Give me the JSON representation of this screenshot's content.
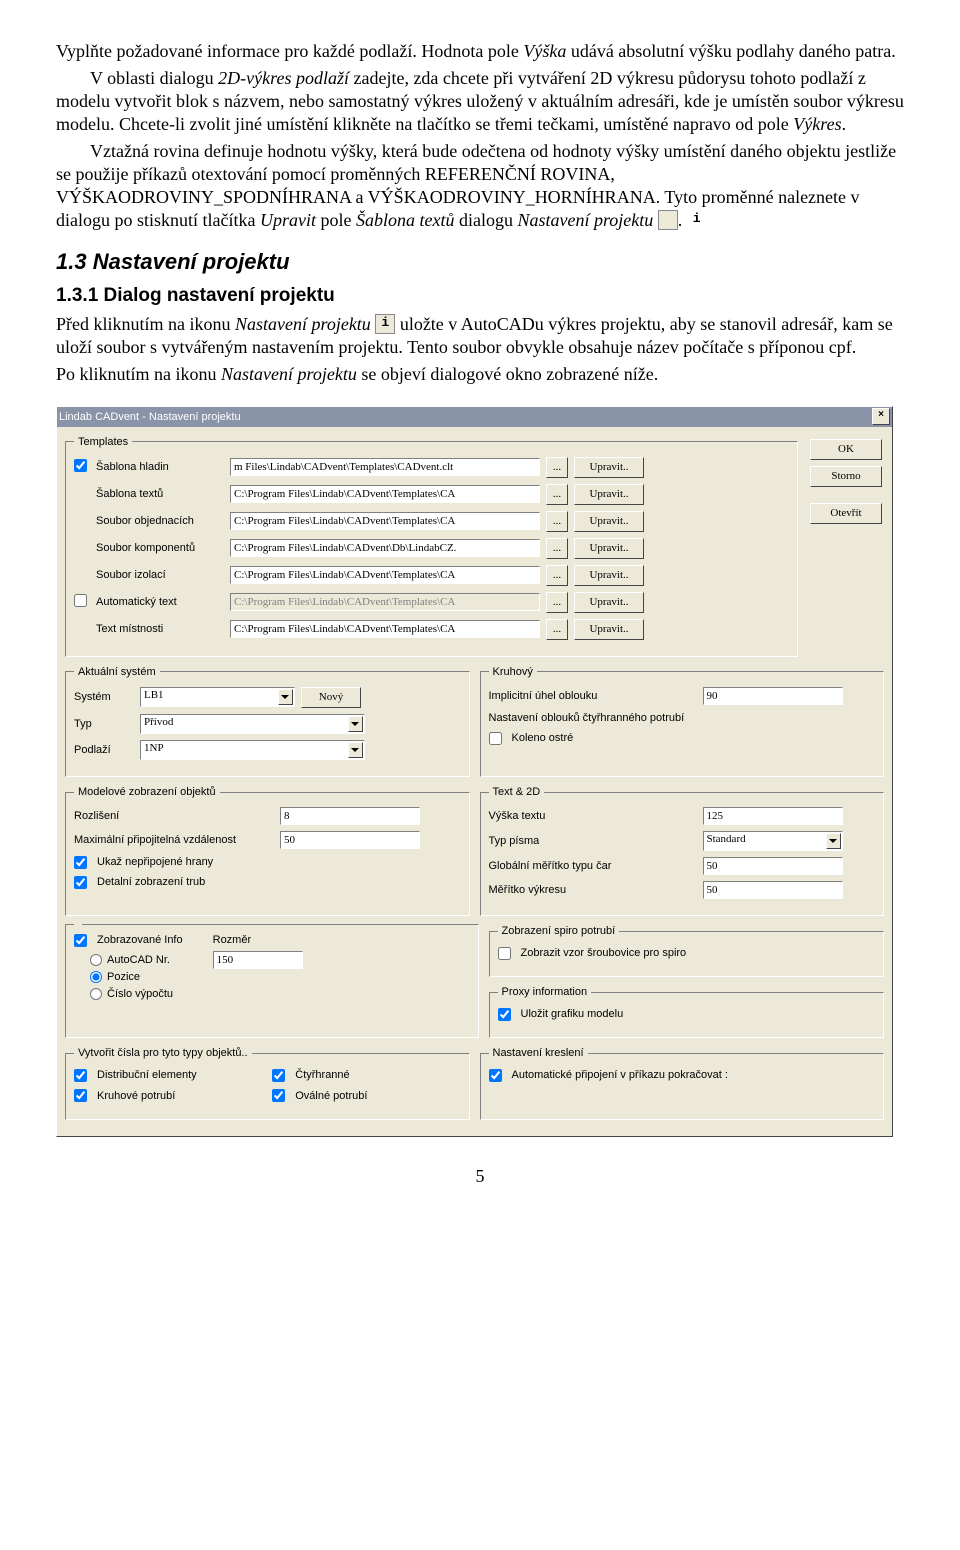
{
  "doc": {
    "p1a": "Vyplňte požadované informace pro každé podlaží. Hodnota pole ",
    "p1b": "Výška",
    "p1c": " udává absolutní výšku podlahy daného patra.",
    "p2a": "V oblasti dialogu ",
    "p2b": "2D-výkres podlaží",
    "p2c": " zadejte, zda chcete při vytváření 2D výkresu půdorysu tohoto podlaží z modelu vytvořit blok s názvem, nebo samostatný výkres uložený v aktuálním adresáři, kde je umístěn soubor výkresu modelu. Chcete-li zvolit jiné umístění klikněte na tlačítko se třemi tečkami, umístěné napravo od pole ",
    "p2d": "Výkres",
    "p2e": ".",
    "p3": "Vztažná rovina definuje hodnotu výšky, která bude odečtena od hodnoty výšky umístění daného objektu jestliže se použije příkazů otextování pomocí proměnných REFERENČNÍ ROVINA, VÝŠKAODROVINY_SPODNÍHRANA a VÝŠKAODROVINY_HORNÍHRANA. Tyto proměnné naleznete v dialogu po stisknutí tlačítka ",
    "p3b": "Upravit",
    "p3c": " pole ",
    "p3d": "Šablona textů",
    "p3e": " dialogu ",
    "p3f": "Nastavení projektu",
    "p3g": ".",
    "h2": "1.3  Nastavení projektu",
    "h3": "1.3.1  Dialog nastavení projektu",
    "p4a": "Před kliknutím na ikonu  ",
    "p4b": "Nastavení projektu",
    "p4c": "  uložte v AutoCADu výkres projektu, aby se stanovil adresář, kam se uloží soubor s vytvářeným nastavením projektu. Tento soubor obvykle obsahuje název počítače s příponou cpf.",
    "p5a": "Po kliknutím na ikonu  ",
    "p5b": "Nastavení projektu",
    "p5c": " se objeví dialogové okno zobrazené níže.",
    "info_i": "i",
    "page": "5"
  },
  "dlg": {
    "title": "Lindab CADvent  -  Nastavení projektu",
    "close": "×",
    "ok": "OK",
    "storno": "Storno",
    "open": "Otevřít",
    "templates": {
      "legend": "Templates",
      "rows": [
        {
          "chk": true,
          "label": "Šablona hladin",
          "val": "m Files\\Lindab\\CADvent\\Templates\\CADvent.clt"
        },
        {
          "chk": null,
          "label": "Šablona textů",
          "val": "C:\\Program Files\\Lindab\\CADvent\\Templates\\CA"
        },
        {
          "chk": null,
          "label": "Soubor objednacích",
          "val": "C:\\Program Files\\Lindab\\CADvent\\Templates\\CA"
        },
        {
          "chk": null,
          "label": "Soubor komponentů",
          "val": "C:\\Program Files\\Lindab\\CADvent\\Db\\LindabCZ."
        },
        {
          "chk": null,
          "label": "Soubor izolací",
          "val": "C:\\Program Files\\Lindab\\CADvent\\Templates\\CA"
        },
        {
          "chk": false,
          "label": "Automatický text",
          "val": "C:\\Program Files\\Lindab\\CADvent\\Templates\\CA",
          "disabled": true
        },
        {
          "chk": null,
          "label": "Text místnosti",
          "val": "C:\\Program Files\\Lindab\\CADvent\\Templates\\CA"
        }
      ],
      "dots": "...",
      "edit": "Upravit.."
    },
    "system": {
      "legend": "Aktuální systém",
      "l_system": "Systém",
      "v_system": "LB1",
      "btn_new": "Nový",
      "l_type": "Typ",
      "v_type": "Přívod",
      "l_floor": "Podlaží",
      "v_floor": "1NP"
    },
    "circ": {
      "legend": "Kruhový",
      "l_angle": "Implicitní úhel oblouku",
      "v_angle": "90",
      "l_bend": "Nastavení oblouků čtyřhranného potrubí",
      "chk_sharp": "Koleno ostré"
    },
    "model": {
      "legend": "Modelové zobrazení objektů",
      "l_res": "Rozlišení",
      "v_res": "8",
      "l_max": "Maximální připojitelná vzdálenost",
      "v_max": "50",
      "chk1": "Ukaž nepřipojené hrany",
      "chk2": "Detalní zobrazení trub"
    },
    "text2d": {
      "legend": "Text & 2D",
      "l_h": "Výška textu",
      "v_h": "125",
      "l_font": "Typ písma",
      "v_font": "Standard",
      "l_lscale": "Globální měřítko typu čar",
      "v_lscale": "50",
      "l_dscale": "Měřítko výkresu",
      "v_dscale": "50"
    },
    "info": {
      "legend_l": " ",
      "chk_info": "Zobrazované Info",
      "r1": "AutoCAD Nr.",
      "r2": "Pozice",
      "r3": "Číslo výpočtu",
      "l_size": "Rozměr",
      "v_size": "150",
      "legend_r1": "Zobrazení spiro potrubí",
      "chk_helix": "Zobrazit vzor šroubovice pro spiro",
      "legend_r2": "Proxy information",
      "chk_proxy": "Uložit grafiku modelu"
    },
    "numgen": {
      "legend": "Vytvořit čísla pro tyto typy objektů..",
      "c1": "Distribuční elementy",
      "c2": "Čtyřhranné",
      "c3": "Kruhové potrubí",
      "c4": "Oválné potrubí"
    },
    "draw": {
      "legend": "Nastavení kreslení",
      "chk": "Automatické připojení v příkazu pokračovat :"
    }
  }
}
